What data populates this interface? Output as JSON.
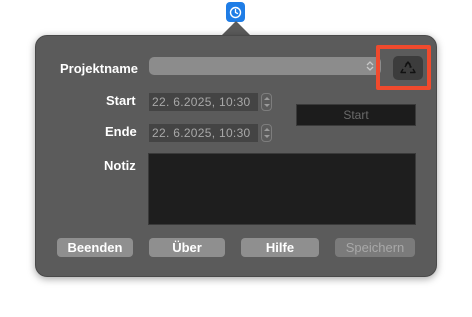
{
  "labels": {
    "project_name": "Projektname",
    "start": "Start",
    "end": "Ende",
    "note": "Notiz"
  },
  "project_select": {
    "value": ""
  },
  "start_date": {
    "value": "22. 6.2025, 10:30"
  },
  "end_date": {
    "value": "22. 6.2025, 10:30"
  },
  "start_button": {
    "label": "Start"
  },
  "note_field": {
    "value": ""
  },
  "buttons": {
    "quit": "Beenden",
    "about": "Über",
    "help": "Hilfe",
    "save": "Speichern"
  },
  "icons": {
    "menubar": "timer-icon",
    "recycle": "recycle-icon"
  },
  "colors": {
    "highlight": "#f04a2d",
    "menubar_icon": "#1f7de6",
    "popover_bg": "#5b5b5b"
  }
}
